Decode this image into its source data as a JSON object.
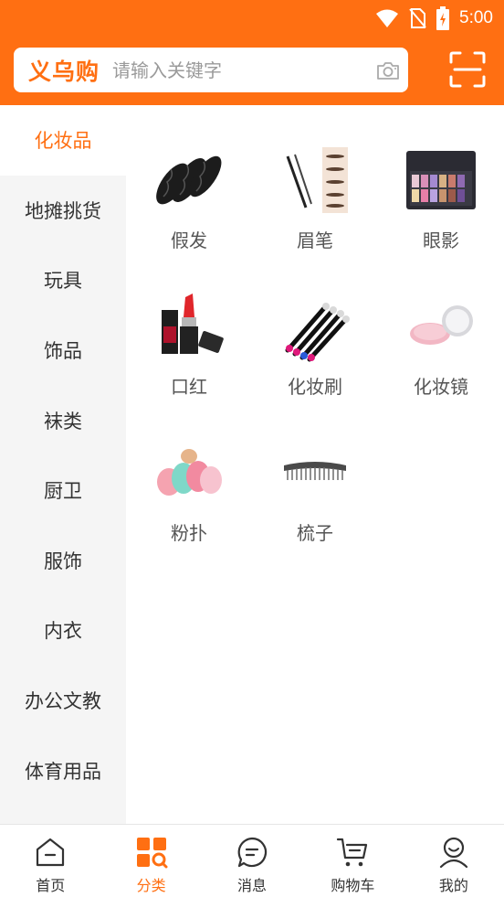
{
  "status_bar": {
    "time": "5:00"
  },
  "header": {
    "brand": "义乌购",
    "search_placeholder": "请输入关键字"
  },
  "sidebar": {
    "items": [
      {
        "label": "化妆品",
        "active": true
      },
      {
        "label": "地摊挑货"
      },
      {
        "label": "玩具"
      },
      {
        "label": "饰品"
      },
      {
        "label": "袜类"
      },
      {
        "label": "厨卫"
      },
      {
        "label": "服饰"
      },
      {
        "label": "内衣"
      },
      {
        "label": "办公文教"
      },
      {
        "label": "体育用品"
      }
    ]
  },
  "grid": {
    "items": [
      {
        "label": "假发",
        "icon": "wig-image"
      },
      {
        "label": "眉笔",
        "icon": "eyebrow-pencil-image"
      },
      {
        "label": "眼影",
        "icon": "eyeshadow-palette-image"
      },
      {
        "label": "口红",
        "icon": "lipstick-image"
      },
      {
        "label": "化妆刷",
        "icon": "makeup-brush-image"
      },
      {
        "label": "化妆镜",
        "icon": "makeup-mirror-image"
      },
      {
        "label": "粉扑",
        "icon": "powder-puff-image"
      },
      {
        "label": "梳子",
        "icon": "comb-image"
      }
    ]
  },
  "tabbar": {
    "items": [
      {
        "label": "首页",
        "icon": "home-icon"
      },
      {
        "label": "分类",
        "icon": "category-icon",
        "active": true
      },
      {
        "label": "消息",
        "icon": "message-icon"
      },
      {
        "label": "购物车",
        "icon": "cart-icon"
      },
      {
        "label": "我的",
        "icon": "profile-icon"
      }
    ]
  },
  "colors": {
    "accent": "#ff6f12",
    "sidebar_bg": "#f5f5f5"
  }
}
